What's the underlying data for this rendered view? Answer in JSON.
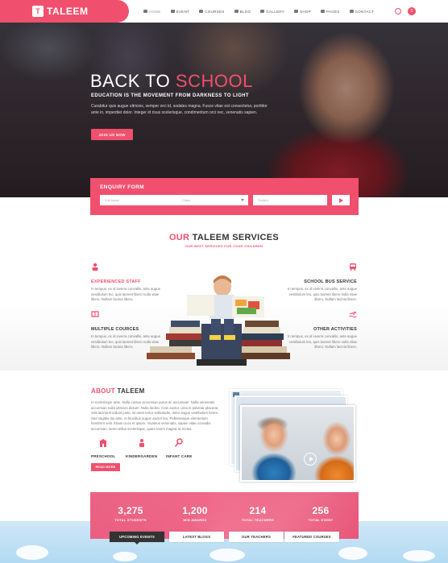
{
  "brand": {
    "logo_mark": "T",
    "name": "TALEEM"
  },
  "nav": [
    {
      "label": "HOME",
      "icon": "home-icon"
    },
    {
      "label": "EVENT",
      "icon": "calendar-icon"
    },
    {
      "label": "COURSES",
      "icon": "graduation-cap-icon"
    },
    {
      "label": "BLOG",
      "icon": "pencil-icon"
    },
    {
      "label": "GALLERY",
      "icon": "image-icon"
    },
    {
      "label": "SHOP",
      "icon": "cart-icon"
    },
    {
      "label": "PAGES",
      "icon": "files-icon"
    },
    {
      "label": "CONTACT",
      "icon": "envelope-icon"
    }
  ],
  "header": {
    "cart_count": "0"
  },
  "hero": {
    "title_white": "BACK TO ",
    "title_pink": "SCHOOL",
    "subtitle": "EDUCATION IS THE MOVEMENT FROM DARKNESS TO LIGHT",
    "paragraph": "Curabitur quis augue ultricies, semper orci id, sodales magna. Fusce vitae est consectetur, porttitor ante in, imperdiet dolor. Integer id risus scelerisque, condimentum orci nec, venenatis sapien.",
    "button": "JOIN US NOW"
  },
  "enquiry": {
    "title": "ENQUIRY FORM",
    "name_placeholder": "Full Name",
    "class_value": "Class",
    "subject_placeholder": "Subject"
  },
  "services": {
    "title_pink": "OUR",
    "title_dark": " TALEEM SERVICES",
    "subtitle": "OUR BEST SERVICES FOR YOUR CHILDREN",
    "items": [
      {
        "title": "EXPERIENCED STAFF",
        "text": "In tempus, ex id viverra convallis, ante augue vestibulum leo, quis laoreet libero nulla vitae libero. Nullam lacinia libero.",
        "icon": "teacher-icon"
      },
      {
        "title": "MULTIPLE COURCES",
        "text": "In tempus, ex id viverra convallis, ante augue vestibulum leo, quis laoreet libero nulla vitae libero. Nullam lacinia libero.",
        "icon": "book-icon"
      },
      {
        "title": "SCHOOL BUS SERVICE",
        "text": "In tempus, ex id viverra convallis, ante augue vestibulum leo, quis laoreet libero nulla vitae libero. Nullam lacinia libero.",
        "icon": "bus-icon"
      },
      {
        "title": "OTHER ACTIVITIES",
        "text": "In tempus, ex id viverra convallis, ante augue vestibulum leo, quis laoreet libero nulla vitae libero. Nullam lacinia libero.",
        "icon": "swimmer-icon"
      }
    ]
  },
  "about": {
    "title_pink": "ABOUT",
    "title_dark": " TALEEM",
    "paragraph": "In scelerisque ante. Nulla cursus accumsan purus ac accumsan. Nulla venenatis accumsan nulla ultricies dictum. Nulla facilisi. Cras auctor, urna in pulvinar placerat, velit lacinia tincidunt justo, sit amet tortor sollicitudin, dolor augue vestibulum lorem. Sed sagittis dui ante, et faucibus augue auctor leo. Pellentesque elementum hendrerit velit. Etiam ut ex et ipsum. Vivamus venenatis, sapien vitae convallis accumsan, lorem tellus scelerisque, quam lorem magna ac lectus.",
    "features": [
      {
        "label": "PRESCHOOL",
        "icon": "preschool-icon"
      },
      {
        "label": "KINDERGARDEN",
        "icon": "kindergarten-icon"
      },
      {
        "label": "INFANT CARE",
        "icon": "infant-care-icon"
      }
    ],
    "button": "READ MORE"
  },
  "stats": [
    {
      "number": "3,275",
      "label": "TOTAL STUDENTS"
    },
    {
      "number": "1,200",
      "label": "WIN AWARDS"
    },
    {
      "number": "214",
      "label": "TOTAL TEACHERS"
    },
    {
      "number": "256",
      "label": "TOTAL EVENT"
    }
  ],
  "tabs": [
    {
      "label": "UPCOMING EVENTS",
      "active": true
    },
    {
      "label": "LATEST BLOGS",
      "active": false
    },
    {
      "label": "OUR TEACHERS",
      "active": false
    },
    {
      "label": "FEATURED COURSES",
      "active": false
    }
  ],
  "colors": {
    "accent": "#f0506e",
    "dark": "#333333",
    "sky": "#b3daf3"
  }
}
